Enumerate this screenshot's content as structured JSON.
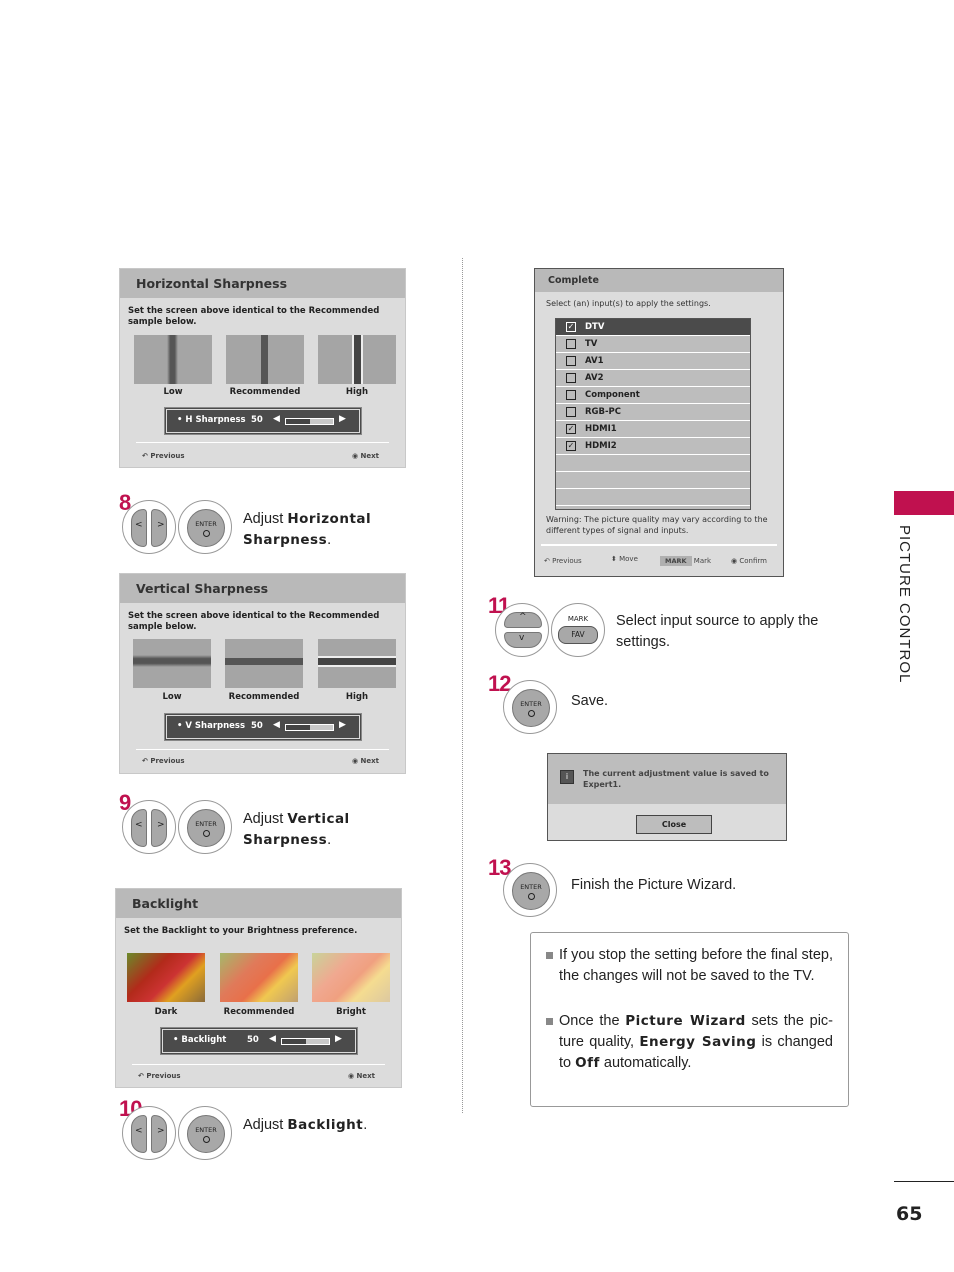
{
  "side_tab": {
    "label": "PICTURE CONTROL",
    "accent_color": "#c0114f"
  },
  "page_number": "65",
  "h_sharpness": {
    "title": "Horizontal Sharpness",
    "description": "Set the screen above identical to the Recommended sample below.",
    "samples": [
      "Low",
      "Recommended",
      "High"
    ],
    "slider": {
      "label": "• H Sharpness",
      "value": "50",
      "level": 0.5
    },
    "footer": {
      "previous": "Previous",
      "next": "Next"
    }
  },
  "step8": {
    "number": "8",
    "prefix": "Adjust ",
    "bold": "Horizontal Sharpness",
    "suffix": "."
  },
  "v_sharpness": {
    "title": "Vertical Sharpness",
    "description": "Set the screen above identical to the Recommended sample below.",
    "samples": [
      "Low",
      "Recommended",
      "High"
    ],
    "slider": {
      "label": "• V Sharpness",
      "value": "50",
      "level": 0.5
    },
    "footer": {
      "previous": "Previous",
      "next": "Next"
    }
  },
  "step9": {
    "number": "9",
    "prefix": "Adjust ",
    "bold": "Vertical Sharpness",
    "suffix": "."
  },
  "backlight": {
    "title": "Backlight",
    "description": "Set the Backlight to your Brightness preference.",
    "samples": [
      "Dark",
      "Recommended",
      "Bright"
    ],
    "slider": {
      "label": "• Backlight",
      "value": "50",
      "level": 0.5
    },
    "footer": {
      "previous": "Previous",
      "next": "Next"
    }
  },
  "step10": {
    "number": "10",
    "prefix": "Adjust ",
    "bold": "Backlight",
    "suffix": "."
  },
  "complete": {
    "title": "Complete",
    "description": "Select (an) input(s) to apply the settings.",
    "inputs": [
      {
        "label": "DTV",
        "checked": true,
        "selected": true
      },
      {
        "label": "TV",
        "checked": false
      },
      {
        "label": "AV1",
        "checked": false
      },
      {
        "label": "AV2",
        "checked": false
      },
      {
        "label": "Component",
        "checked": false
      },
      {
        "label": "RGB-PC",
        "checked": false
      },
      {
        "label": "HDMI1",
        "checked": true
      },
      {
        "label": "HDMI2",
        "checked": true
      },
      {
        "label": ""
      },
      {
        "label": ""
      },
      {
        "label": ""
      }
    ],
    "warning": "Warning: The picture quality may vary according to the different types of signal and inputs.",
    "footer": {
      "previous": "Previous",
      "move": "Move",
      "mark_key": "MARK",
      "mark": "Mark",
      "confirm": "Confirm"
    }
  },
  "step11": {
    "number": "11",
    "text": "Select input source to apply the settings.",
    "mark_label": "MARK",
    "fav_label": "FAV"
  },
  "step12": {
    "number": "12",
    "text": "Save."
  },
  "saved_dialog": {
    "icon": "i",
    "message": "The current adjustment value is saved to Expert1.",
    "close_label": "Close"
  },
  "step13": {
    "number": "13",
    "text": "Finish the Picture Wizard."
  },
  "remote": {
    "enter_label": "ENTER"
  },
  "notes": {
    "note1": "If you stop the setting before the final step, the changes will not be saved to the TV.",
    "note2_a": "Once the ",
    "note2_b": "Picture Wizard",
    "note2_c": " sets the pic-ture quality, ",
    "note2_d": "Energy Saving",
    "note2_e": " is changed to ",
    "note2_f": "Off",
    "note2_g": " automatically."
  }
}
